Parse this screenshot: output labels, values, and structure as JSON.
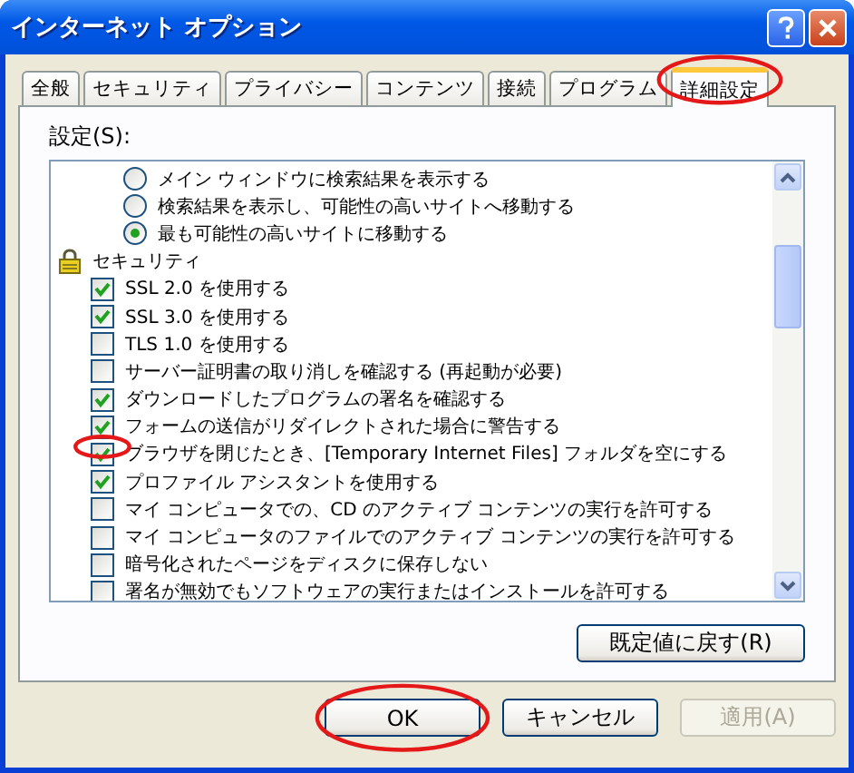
{
  "window": {
    "title": "インターネット オプション"
  },
  "tabs": [
    {
      "label": "全般",
      "selected": false,
      "circled": false
    },
    {
      "label": "セキュリティ",
      "selected": false,
      "circled": false
    },
    {
      "label": "プライバシー",
      "selected": false,
      "circled": false
    },
    {
      "label": "コンテンツ",
      "selected": false,
      "circled": false
    },
    {
      "label": "接続",
      "selected": false,
      "circled": false
    },
    {
      "label": "プログラム",
      "selected": false,
      "circled": false
    },
    {
      "label": "詳細設定",
      "selected": true,
      "circled": true
    }
  ],
  "settings": {
    "label": "設定(S):",
    "radio_options": [
      {
        "label": "メイン ウィンドウに検索結果を表示する",
        "selected": false
      },
      {
        "label": "検索結果を表示し、可能性の高いサイトへ移動する",
        "selected": false
      },
      {
        "label": "最も可能性の高いサイトに移動する",
        "selected": true
      }
    ],
    "groups": [
      {
        "label": "セキュリティ",
        "children": [
          {
            "label": "SSL 2.0 を使用する",
            "checked": true,
            "circled": false
          },
          {
            "label": "SSL 3.0 を使用する",
            "checked": true,
            "circled": false
          },
          {
            "label": "TLS 1.0 を使用する",
            "checked": false,
            "circled": false
          },
          {
            "label": "サーバー証明書の取り消しを確認する (再起動が必要)",
            "checked": false,
            "circled": false
          },
          {
            "label": "ダウンロードしたプログラムの署名を確認する",
            "checked": true,
            "circled": false
          },
          {
            "label": "フォームの送信がリダイレクトされた場合に警告する",
            "checked": true,
            "circled": false
          },
          {
            "label": "ブラウザを閉じたとき、[Temporary Internet Files] フォルダを空にする",
            "checked": true,
            "circled": true
          },
          {
            "label": "プロファイル アシスタントを使用する",
            "checked": true,
            "circled": false
          },
          {
            "label": "マイ コンピュータでの、CD のアクティブ コンテンツの実行を許可する",
            "checked": false,
            "circled": false
          },
          {
            "label": "マイ コンピュータのファイルでのアクティブ コンテンツの実行を許可する",
            "checked": false,
            "circled": false
          },
          {
            "label": "暗号化されたページをディスクに保存しない",
            "checked": false,
            "circled": false
          },
          {
            "label": "署名が無効でもソフトウェアの実行またはインストールを許可する",
            "checked": false,
            "circled": false
          }
        ]
      }
    ],
    "reset_button": "既定値に戻す(R)"
  },
  "buttons": [
    {
      "label": "OK",
      "disabled": false,
      "circled": true
    },
    {
      "label": "キャンセル",
      "disabled": false,
      "circled": false
    },
    {
      "label": "適用(A)",
      "disabled": true,
      "circled": false
    }
  ]
}
